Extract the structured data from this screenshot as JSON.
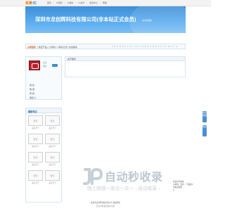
{
  "header": {
    "logo_part1": "买卖",
    "logo_part2": "IC",
    "nav": [
      "首页",
      "|",
      "IC现货",
      "|",
      "IC报价",
      "|",
      "IC资讯",
      "|",
      "会员中心",
      "|",
      "帮助"
    ]
  },
  "banner": {
    "title": "深圳市龙创辉科技有限公司(非本站正式会员)",
    "subtitle": "(在线客服)"
  },
  "navbar": {
    "home": "公司首页",
    "crumbs": "| 供应产品 | 公司简介 | 联系方式 | 在线留言",
    "letters": "A B C D E F G H I J K L M N O P Q R S T U V W X Y Z"
  },
  "profile": {
    "mini_name": "龙创",
    "mini_name2": "级别",
    "rows": [
      "地 址:",
      "电 话:",
      "传 真:",
      "联系人:"
    ]
  },
  "main": {
    "header": "关于我们"
  },
  "products": {
    "header": "最新供应",
    "items": [
      {
        "thumb": "暂无",
        "cap": "品名型号"
      },
      {
        "thumb": "暂无",
        "cap": "品名型号"
      },
      {
        "thumb": "暂无",
        "cap": "品名型号"
      },
      {
        "thumb": "暂无",
        "cap": "品名型号"
      },
      {
        "thumb": "暂无",
        "cap": "品名型号"
      },
      {
        "thumb": "暂无",
        "cap": "品名型号"
      },
      {
        "thumb": "暂无",
        "cap": "品名型号"
      },
      {
        "thumb": "暂无",
        "cap": "品名型号"
      }
    ]
  },
  "side_buttons": [
    "在线客服",
    "留言"
  ],
  "side_ad": {
    "line1": "欢迎访问本站",
    "line2": "IC采购、现货、产品报价",
    "line3": "请联系客服",
    "tick": "☑"
  },
  "watermark": {
    "title": "自动秒收录",
    "subtitle": "随上随搜一来访一次一→自动收录→"
  },
  "footer": {
    "line1": "深圳市龙创辉科技有限公司 版权所有",
    "line2": "买卖IC网 提供技术支持"
  },
  "colors": {
    "banner": "#3c8fd6",
    "accent": "#e26b0a",
    "brand": "#2b6fb8"
  }
}
